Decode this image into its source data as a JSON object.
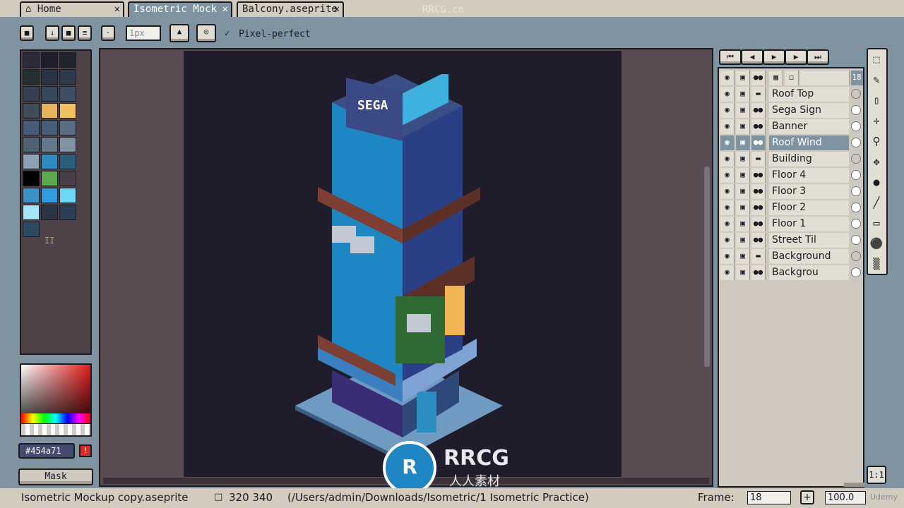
{
  "tabs": [
    {
      "label": "Home",
      "icon": "home-icon"
    },
    {
      "label": "Isometric Mock",
      "active": true
    },
    {
      "label": "Balcony.aseprite"
    }
  ],
  "watermark": "RRCG.cn",
  "toolbar": {
    "brush_size_value": "1px",
    "pixel_perfect_label": "Pixel-perfect",
    "pixel_perfect_checked": true
  },
  "palette": {
    "colors": [
      "#2c2b3a",
      "#1f1e2c",
      "#20242f",
      "#242f2f",
      "#2b3447",
      "#2f3a4c",
      "#363e52",
      "#37485a",
      "#3e4f65",
      "#3d4b5b",
      "#e6b45a",
      "#f3c060",
      "#465a7a",
      "#485d79",
      "#5b6d82",
      "#4d6273",
      "#627a8c",
      "#7f93a0",
      "#8aa2b4",
      "#2e8cc2",
      "#2b5f7b",
      "#000000",
      "#5ea94f",
      "#4a3f48",
      "#3b92c8",
      "#2f9be0",
      "#6ed7f7",
      "#a3e4f9",
      "#2b3544",
      "#2c3e55",
      "#2e4a63"
    ],
    "marker": "II"
  },
  "color": {
    "hex_value": "#454a71",
    "mask_label": "Mask"
  },
  "animation": {
    "frame_count_badge": "18"
  },
  "layers": [
    {
      "name": "Roof Top",
      "group": true
    },
    {
      "name": "Sega Sign"
    },
    {
      "name": "Banner"
    },
    {
      "name": "Roof Wind",
      "selected": true
    },
    {
      "name": "Building",
      "group": true
    },
    {
      "name": "Floor 4"
    },
    {
      "name": "Floor 3"
    },
    {
      "name": "Floor 2"
    },
    {
      "name": "Floor 1"
    },
    {
      "name": "Street Til"
    },
    {
      "name": "Background",
      "group": true
    },
    {
      "name": "Backgrou"
    }
  ],
  "tools": [
    "rectangular-marquee-icon",
    "pencil-icon",
    "eraser-icon",
    "eyedropper-icon",
    "zoom-icon",
    "move-icon",
    "paint-bucket-icon",
    "line-icon",
    "rectangle-icon",
    "blob-icon",
    "blur-icon"
  ],
  "sign_text": "SEGA",
  "canvas_zoom_button": "1:1",
  "status": {
    "filename": "Isometric Mockup copy.aseprite",
    "dimensions": "320 340",
    "path": "(/Users/admin/Downloads/Isometric/1 Isometric Practice)",
    "frame_label": "Frame:",
    "frame_value": "18",
    "zoom_value": "100.0",
    "udemy": "Udemy"
  },
  "logo_text": "RRCG",
  "logo_subtext": "人人素材"
}
